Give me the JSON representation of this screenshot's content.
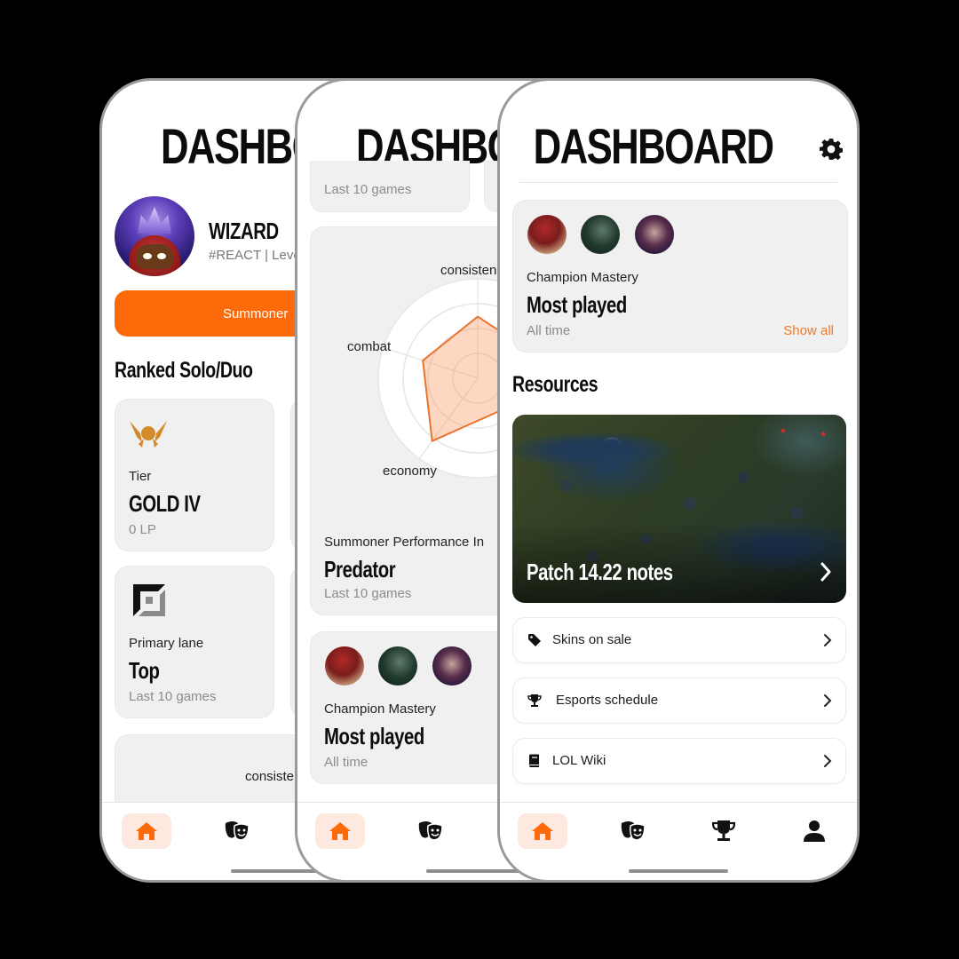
{
  "app": {
    "title": "DASHBOARD",
    "accent_color": "#fd6a0a"
  },
  "phone1": {
    "title": "DASHBO",
    "profile": {
      "name": "WIZARD",
      "tag_line": "#REACT | Leve"
    },
    "summoner_button": "Summoner",
    "section_title": "Ranked Solo/Duo",
    "tier_card": {
      "icon": "gold-rank-wings-icon",
      "label": "Tier",
      "value": "GOLD IV",
      "sub": "0 LP"
    },
    "lane_card": {
      "icon": "top-lane-icon",
      "label": "Primary lane",
      "value": "Top",
      "sub": "Last 10 games"
    },
    "radar_peek_label": "consiste"
  },
  "phone2": {
    "title": "DASHBO",
    "top_card_sub": "Last 10 games",
    "radar": {
      "axis_labels": [
        "consisten",
        "combat",
        "economy"
      ],
      "label": "Summoner Performance In",
      "value": "Predator",
      "sub": "Last 10 games"
    },
    "mastery": {
      "label": "Champion Mastery",
      "value": "Most played",
      "sub": "All time"
    }
  },
  "phone3": {
    "title": "DASHBOARD",
    "settings_icon": "gear-icon",
    "mastery": {
      "label": "Champion Mastery",
      "value": "Most played",
      "sub": "All time",
      "link": "Show all"
    },
    "resources_title": "Resources",
    "patch_card": {
      "title": "Patch 14.22 notes"
    },
    "resources": [
      {
        "icon": "tag-icon",
        "label": "Skins on sale"
      },
      {
        "icon": "trophy-icon",
        "label": "Esports schedule"
      },
      {
        "icon": "book-icon",
        "label": "LOL Wiki"
      }
    ]
  },
  "nav": {
    "items": [
      {
        "icon": "home-icon",
        "active": true
      },
      {
        "icon": "masks-icon",
        "active": false
      },
      {
        "icon": "trophy-icon",
        "active": false
      },
      {
        "icon": "user-icon",
        "active": false
      }
    ]
  },
  "chart_data": {
    "type": "radar",
    "title": "Summoner Performance Index",
    "axes": [
      "consistency",
      "combat",
      "economy"
    ],
    "note": "Radar partially occluded; only left portion visible",
    "series": [
      {
        "name": "Predator",
        "visible_vertices": {
          "consistency": 0.62,
          "combat": 0.58,
          "economy": 0.78
        }
      }
    ]
  }
}
